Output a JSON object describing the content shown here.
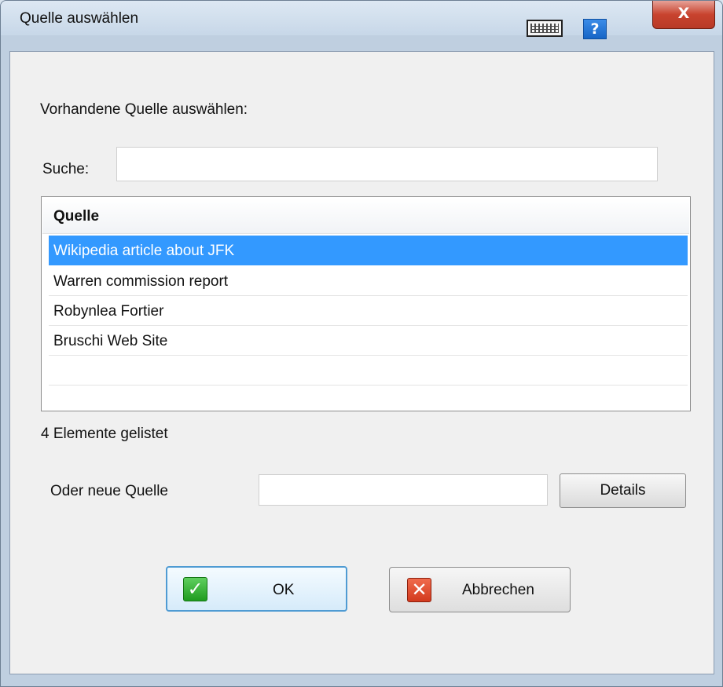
{
  "window": {
    "title": "Quelle auswählen",
    "help_glyph": "?",
    "close_glyph": "X",
    "icons": [
      "keyboard-icon",
      "help-icon",
      "close-icon"
    ]
  },
  "prompt": "Vorhandene Quelle auswählen:",
  "search": {
    "label": "Suche:",
    "value": "",
    "placeholder": ""
  },
  "list": {
    "column_header": "Quelle",
    "rows": [
      {
        "label": "Wikipedia article about JFK",
        "selected": true
      },
      {
        "label": "Warren commission report",
        "selected": false
      },
      {
        "label": "Robynlea Fortier",
        "selected": false
      },
      {
        "label": "Bruschi Web Site",
        "selected": false
      }
    ],
    "selection_color": "#3399ff"
  },
  "count_text": "4 Elemente gelistet",
  "new_source": {
    "label": "Oder neue Quelle",
    "value": "",
    "details_button": "Details"
  },
  "buttons": {
    "ok": {
      "label": "OK",
      "icon": "check-icon",
      "glyph": "✓"
    },
    "cancel": {
      "label": "Abbrechen",
      "icon": "cross-icon",
      "glyph": "✕"
    }
  }
}
